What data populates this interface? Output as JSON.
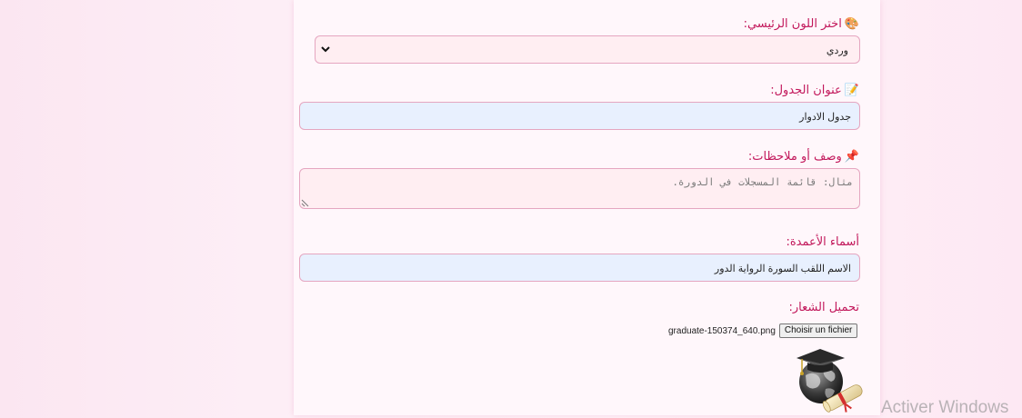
{
  "form": {
    "color_label": "اختر اللون الرئيسي:",
    "color_icon": "palette-icon",
    "color_value": "وردي",
    "title_label": "عنوان الجدول:",
    "title_icon": "memo-icon",
    "title_value": "جدول الادوار",
    "desc_label": "وصف أو ملاحظات:",
    "desc_icon": "pushpin-icon",
    "desc_placeholder": "مثال: قائمة المسجلات في الدورة.",
    "columns_label": "أسماء الأعمدة:",
    "columns_value": "الاسم اللقب السورة الرواية الدور",
    "logo_label": "تحميل الشعار:",
    "file_button": "Choisir un fichier",
    "file_name": "graduate-150374_640.png"
  },
  "os": {
    "watermark": "Activer Windows"
  },
  "colors": {
    "label": "#c2185b",
    "border": "#e5a6c0",
    "pink_field": "#ffeef2",
    "blue_field": "#e8f0fe"
  }
}
